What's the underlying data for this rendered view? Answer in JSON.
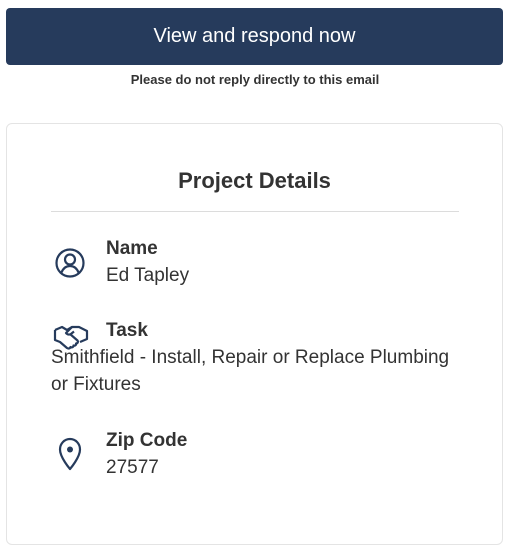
{
  "cta": {
    "label": "View and respond now"
  },
  "notice": "Please do not reply directly to this email",
  "card": {
    "title": "Project Details",
    "details": [
      {
        "icon": "user-circle-icon",
        "label": "Name",
        "value": "Ed Tapley"
      },
      {
        "icon": "handshake-icon",
        "label": "Task",
        "value": "Smithfield - Install, Repair or Replace Plumbing or Fixtures"
      },
      {
        "icon": "location-pin-icon",
        "label": "Zip Code",
        "value": "27577"
      }
    ]
  },
  "colors": {
    "button_bg": "#263b5c",
    "icon": "#263b5c",
    "text": "#333333"
  }
}
